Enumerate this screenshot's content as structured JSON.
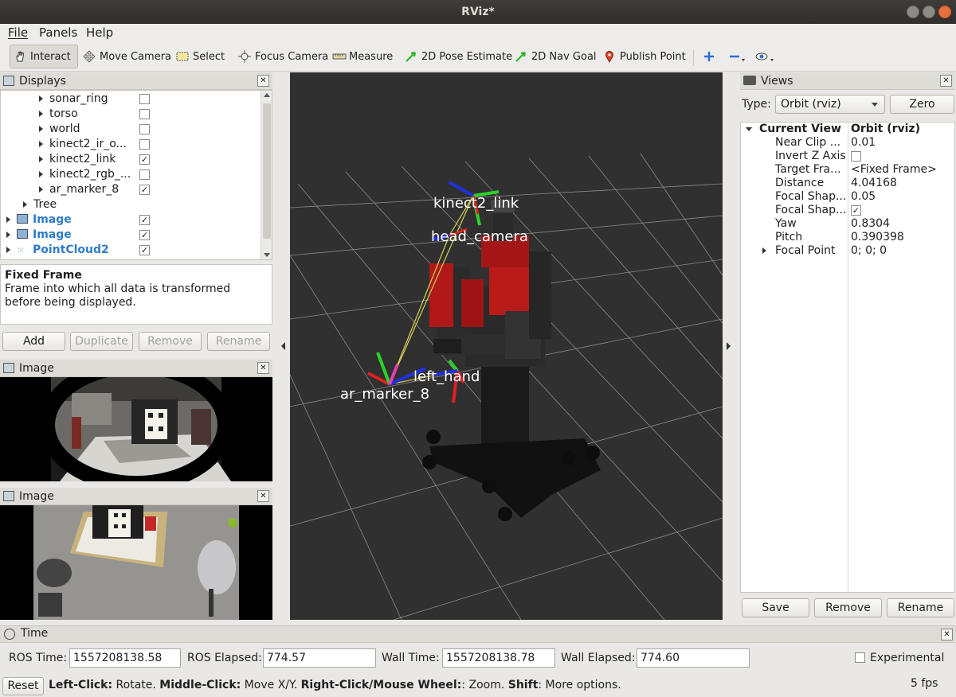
{
  "window": {
    "title": "RViz*"
  },
  "menu": [
    "File",
    "Panels",
    "Help"
  ],
  "toolbar": {
    "interact": "Interact",
    "move_camera": "Move Camera",
    "select": "Select",
    "focus_camera": "Focus Camera",
    "measure": "Measure",
    "pose_estimate": "2D Pose Estimate",
    "nav_goal": "2D Nav Goal",
    "publish_point": "Publish Point"
  },
  "displays": {
    "title": "Displays",
    "items": [
      {
        "label": "sonar_ring",
        "checked": false
      },
      {
        "label": "torso",
        "checked": false
      },
      {
        "label": "world",
        "checked": false
      },
      {
        "label": "kinect2_ir_o...",
        "checked": false
      },
      {
        "label": "kinect2_link",
        "checked": true
      },
      {
        "label": "kinect2_rgb_...",
        "checked": false
      },
      {
        "label": "ar_marker_8",
        "checked": true
      },
      {
        "label": "Tree"
      },
      {
        "label": "Image",
        "checked": true
      },
      {
        "label": "Image",
        "checked": true
      },
      {
        "label": "PointCloud2",
        "checked": true
      }
    ],
    "desc_title": "Fixed Frame",
    "desc_text": "Frame into which all data is transformed before being displayed.",
    "buttons": {
      "add": "Add",
      "duplicate": "Duplicate",
      "remove": "Remove",
      "rename": "Rename"
    }
  },
  "image_panels": [
    {
      "title": "Image"
    },
    {
      "title": "Image"
    }
  ],
  "viewport": {
    "labels": {
      "kinect": "kinect2_link",
      "head": "head_camera",
      "hand": "left_hand",
      "marker": "ar_marker_8"
    }
  },
  "views": {
    "title": "Views",
    "type_label": "Type:",
    "type_value": "Orbit (rviz)",
    "zero": "Zero",
    "current_view_label": "Current View",
    "current_view_value": "Orbit (rviz)",
    "props": [
      {
        "key": "Near Clip ...",
        "value": "0.01"
      },
      {
        "key": "Invert Z Axis",
        "value": "",
        "checkbox": false
      },
      {
        "key": "Target Fra...",
        "value": "<Fixed Frame>"
      },
      {
        "key": "Distance",
        "value": "4.04168"
      },
      {
        "key": "Focal Shap...",
        "value": "0.05"
      },
      {
        "key": "Focal Shap...",
        "value": "",
        "checkbox": true
      },
      {
        "key": "Yaw",
        "value": "0.8304"
      },
      {
        "key": "Pitch",
        "value": "0.390398"
      },
      {
        "key": "Focal Point",
        "value": "0; 0; 0"
      }
    ],
    "buttons": {
      "save": "Save",
      "remove": "Remove",
      "rename": "Rename"
    }
  },
  "time": {
    "title": "Time",
    "ros_time_label": "ROS Time:",
    "ros_time": "1557208138.58",
    "ros_elapsed_label": "ROS Elapsed:",
    "ros_elapsed": "774.57",
    "wall_time_label": "Wall Time:",
    "wall_time": "1557208138.78",
    "wall_elapsed_label": "Wall Elapsed:",
    "wall_elapsed": "774.60",
    "experimental": "Experimental"
  },
  "status": {
    "reset": "Reset",
    "hint_1b": "Left-Click:",
    "hint_1": " Rotate. ",
    "hint_2b": "Middle-Click:",
    "hint_2": " Move X/Y. ",
    "hint_3b": "Right-Click/Mouse Wheel:",
    "hint_3": ": Zoom. ",
    "hint_4b": "Shift",
    "hint_4": ": More options.",
    "fps": "5 fps"
  }
}
